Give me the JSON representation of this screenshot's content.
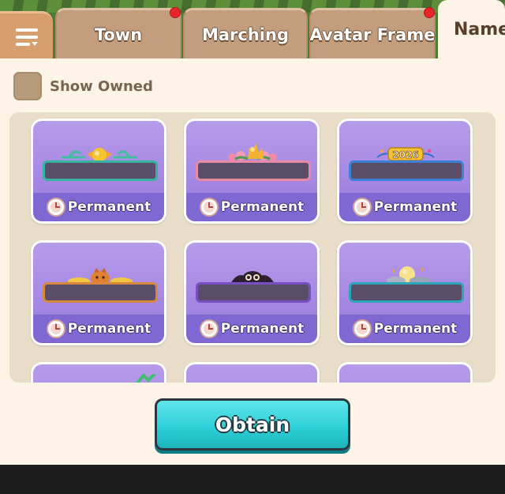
{
  "tabs": [
    {
      "label": "Town",
      "notification": true
    },
    {
      "label": "Marching",
      "notification": false
    },
    {
      "label": "Avatar Frame",
      "notification": true
    },
    {
      "label": "Namep",
      "active": true
    }
  ],
  "filter": {
    "show_owned_label": "Show Owned",
    "checked": false
  },
  "cards": [
    {
      "duration": "Permanent",
      "plate_color": "#35b39c",
      "decoration": "candy-ornament"
    },
    {
      "duration": "Permanent",
      "plate_color": "#e88aa6",
      "decoration": "flower-crown"
    },
    {
      "duration": "Permanent",
      "plate_color": "#3d7fd4",
      "decoration": "2026-sign"
    },
    {
      "duration": "Permanent",
      "plate_color": "#d7883c",
      "decoration": "pumpkin-cat"
    },
    {
      "duration": "Permanent",
      "plate_color": "#7a4fc4",
      "decoration": "bat"
    },
    {
      "duration": "Permanent",
      "plate_color": "#2ea4b9",
      "decoration": "moon-clouds"
    }
  ],
  "obtain_button": {
    "label": "Obtain"
  },
  "colors": {
    "accent_teal": "#2fd0d8",
    "card_purple": "#7f68d2",
    "panel_bg": "#fcf4e6"
  }
}
